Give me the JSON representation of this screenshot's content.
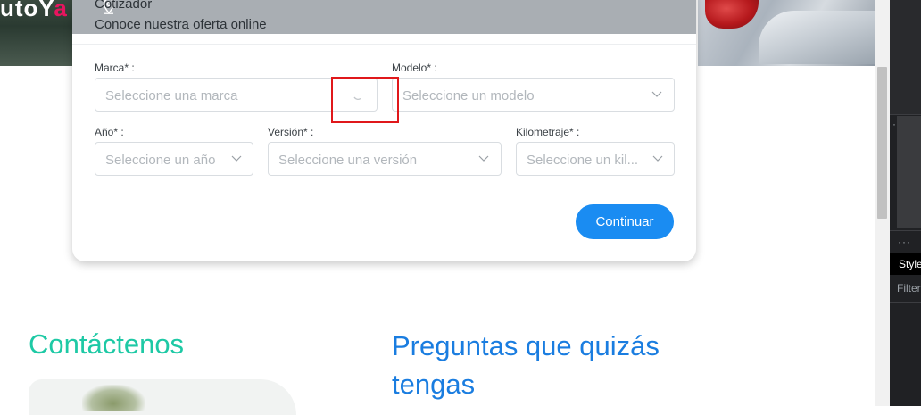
{
  "brand": {
    "logo_white": "utoY",
    "logo_accent": "a"
  },
  "modal": {
    "title": "Cotizador",
    "subtitle": "Conoce nuestra oferta online",
    "fields": {
      "marca": {
        "label": "Marca* :",
        "placeholder": "Seleccione una marca"
      },
      "modelo": {
        "label": "Modelo* :",
        "placeholder": "Seleccione un modelo"
      },
      "anio": {
        "label": "Año* :",
        "placeholder": "Seleccione un año"
      },
      "version": {
        "label": "Versión* :",
        "placeholder": "Seleccione una versión"
      },
      "kilometraje": {
        "label": "Kilometraje* :",
        "placeholder": "Seleccione un kil..."
      }
    },
    "continue_label": "Continuar"
  },
  "page": {
    "contact_title": "Contáctenos",
    "faq_title": "Preguntas que quizás tengas"
  },
  "devtools": {
    "dots": "···",
    "styles_tab": "Styles",
    "filter_label": "Filter"
  },
  "colors": {
    "accent_blue": "#1a8cf2",
    "contact_teal": "#1ec9a5",
    "faq_blue": "#1a7de0",
    "logo_pink": "#e8155f",
    "highlight_red": "#e0181b"
  },
  "icons": [
    "location-pin-icon",
    "chevron-down-icon",
    "loading-spinner-icon"
  ]
}
